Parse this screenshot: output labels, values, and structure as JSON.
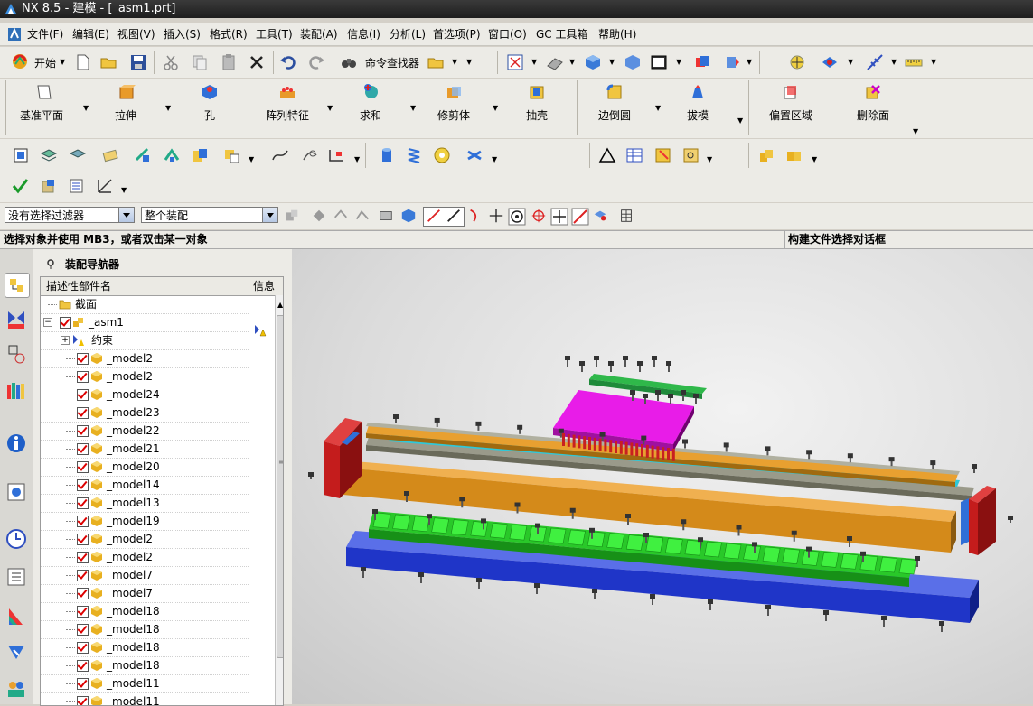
{
  "window": {
    "title": "NX 8.5 - 建模 - [_asm1.prt]"
  },
  "menu": [
    "文件(F)",
    "编辑(E)",
    "视图(V)",
    "插入(S)",
    "格式(R)",
    "工具(T)",
    "装配(A)",
    "信息(I)",
    "分析(L)",
    "首选项(P)",
    "窗口(O)",
    "GC 工具箱",
    "帮助(H)"
  ],
  "toolbar1": {
    "start_label": "开始",
    "cmd_finder_label": "命令查找器"
  },
  "feature_toolbar": [
    {
      "label": "基准平面",
      "icon": "datum-plane-icon"
    },
    {
      "label": "拉伸",
      "icon": "extrude-icon"
    },
    {
      "label": "孔",
      "icon": "hole-icon"
    },
    {
      "label": "阵列特征",
      "icon": "pattern-feature-icon"
    },
    {
      "label": "求和",
      "icon": "unite-icon"
    },
    {
      "label": "修剪体",
      "icon": "trim-body-icon"
    },
    {
      "label": "抽壳",
      "icon": "shell-icon"
    },
    {
      "label": "边倒圆",
      "icon": "edge-blend-icon"
    },
    {
      "label": "拔模",
      "icon": "draft-icon"
    },
    {
      "label": "偏置区域",
      "icon": "offset-region-icon"
    },
    {
      "label": "删除面",
      "icon": "delete-face-icon"
    }
  ],
  "selection_bar": {
    "filter": "没有选择过滤器",
    "scope": "整个装配"
  },
  "cue_line": {
    "prompt": "选择对象并使用 MB3，或者双击某一对象",
    "status": "构建文件选择对话框"
  },
  "assembly_navigator": {
    "title": "装配导航器",
    "columns": [
      "描述性部件名",
      "信息"
    ],
    "rows": [
      {
        "label": "截面",
        "level": 1,
        "type": "folder"
      },
      {
        "label": "_asm1",
        "level": 1,
        "type": "assembly"
      },
      {
        "label": "约束",
        "level": 2,
        "type": "constraints"
      },
      {
        "label": "_model2",
        "level": 2,
        "type": "part"
      },
      {
        "label": "_model2",
        "level": 2,
        "type": "part"
      },
      {
        "label": "_model24",
        "level": 2,
        "type": "part"
      },
      {
        "label": "_model23",
        "level": 2,
        "type": "part"
      },
      {
        "label": "_model22",
        "level": 2,
        "type": "part"
      },
      {
        "label": "_model21",
        "level": 2,
        "type": "part"
      },
      {
        "label": "_model20",
        "level": 2,
        "type": "part"
      },
      {
        "label": "_model14",
        "level": 2,
        "type": "part"
      },
      {
        "label": "_model13",
        "level": 2,
        "type": "part"
      },
      {
        "label": "_model19",
        "level": 2,
        "type": "part"
      },
      {
        "label": "_model2",
        "level": 2,
        "type": "part"
      },
      {
        "label": "_model2",
        "level": 2,
        "type": "part"
      },
      {
        "label": "_model7",
        "level": 2,
        "type": "part"
      },
      {
        "label": "_model7",
        "level": 2,
        "type": "part"
      },
      {
        "label": "_model18",
        "level": 2,
        "type": "part"
      },
      {
        "label": "_model18",
        "level": 2,
        "type": "part"
      },
      {
        "label": "_model18",
        "level": 2,
        "type": "part"
      },
      {
        "label": "_model18",
        "level": 2,
        "type": "part"
      },
      {
        "label": "_model11",
        "level": 2,
        "type": "part"
      },
      {
        "label": "_model11",
        "level": 2,
        "type": "part"
      }
    ]
  },
  "colors": {
    "part_blue": "#1f35c8",
    "part_green": "#2fe02f",
    "part_orange": "#d48a1a",
    "part_red": "#c41c1c",
    "part_magenta": "#e01ce0",
    "part_cyan": "#1aa8b8",
    "part_dkgreen": "#1f9a3a"
  }
}
